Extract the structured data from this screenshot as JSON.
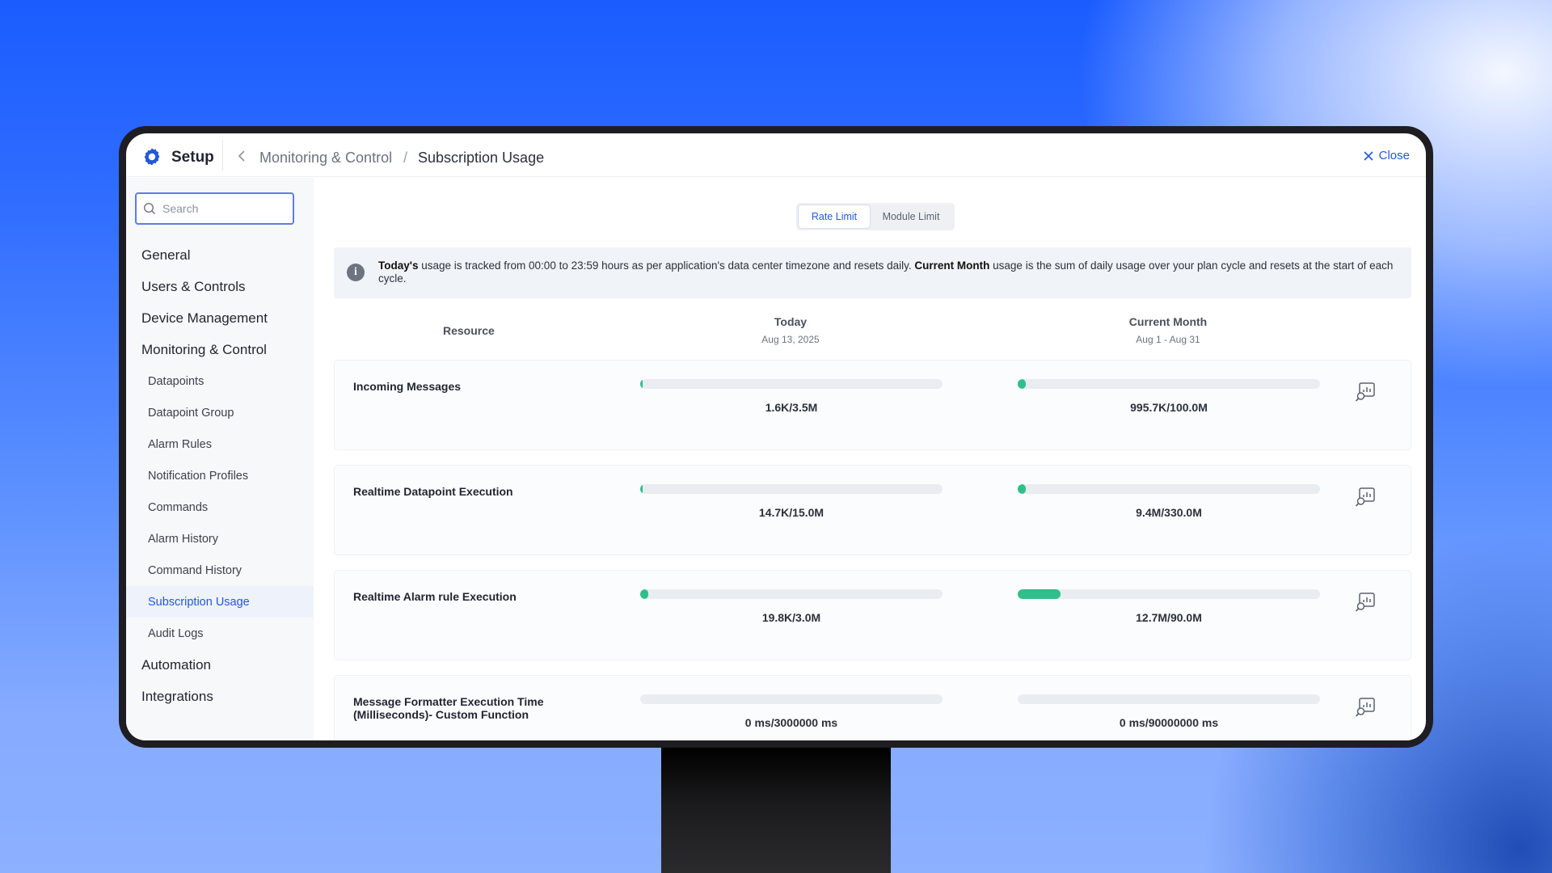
{
  "header": {
    "app_title": "Setup",
    "breadcrumb_parent": "Monitoring & Control",
    "breadcrumb_separator": "/",
    "breadcrumb_current": "Subscription Usage",
    "close_label": "Close"
  },
  "sidebar": {
    "search_placeholder": "Search",
    "items": [
      {
        "label": "General",
        "level": "top"
      },
      {
        "label": "Users & Controls",
        "level": "top"
      },
      {
        "label": "Device Management",
        "level": "top"
      },
      {
        "label": "Monitoring & Control",
        "level": "top"
      },
      {
        "label": "Datapoints",
        "level": "sub"
      },
      {
        "label": "Datapoint Group",
        "level": "sub"
      },
      {
        "label": "Alarm Rules",
        "level": "sub"
      },
      {
        "label": "Notification Profiles",
        "level": "sub"
      },
      {
        "label": "Commands",
        "level": "sub"
      },
      {
        "label": "Alarm History",
        "level": "sub"
      },
      {
        "label": "Command History",
        "level": "sub"
      },
      {
        "label": "Subscription Usage",
        "level": "sub",
        "active": true
      },
      {
        "label": "Audit Logs",
        "level": "sub"
      },
      {
        "label": "Automation",
        "level": "top"
      },
      {
        "label": "Integrations",
        "level": "top"
      }
    ]
  },
  "tabs": {
    "rate_limit": "Rate Limit",
    "module_limit": "Module Limit",
    "selected": "Rate Limit"
  },
  "info": {
    "today_bold": "Today's",
    "text_1": " usage is tracked from 00:00 to 23:59 hours as per application's data center timezone and resets daily. ",
    "month_bold": "Current Month",
    "text_2": " usage is the sum of daily usage over your plan cycle and resets at the start of each cycle."
  },
  "columns": {
    "resource": "Resource",
    "today": "Today",
    "today_date": "Aug 13, 2025",
    "month": "Current Month",
    "month_range": "Aug 1 - Aug 31"
  },
  "rows": [
    {
      "name": "Incoming Messages",
      "today_value": "1.6K/3.5M",
      "today_fraction": 0.0005,
      "month_value": "995.7K/100.0M",
      "month_fraction": 0.01
    },
    {
      "name": "Realtime Datapoint Execution",
      "today_value": "14.7K/15.0M",
      "today_fraction": 0.001,
      "month_value": "9.4M/330.0M",
      "month_fraction": 0.028
    },
    {
      "name": "Realtime Alarm rule Execution",
      "today_value": "19.8K/3.0M",
      "today_fraction": 0.0066,
      "month_value": "12.7M/90.0M",
      "month_fraction": 0.141
    },
    {
      "name": "Message Formatter Execution Time (Milliseconds)- Custom Function",
      "today_value": "0 ms/3000000 ms",
      "today_fraction": 0,
      "month_value": "0 ms/90000000 ms",
      "month_fraction": 0
    }
  ],
  "colors": {
    "accent": "#2458d6",
    "progress": "#2ebf8a",
    "track": "#e9ecf0"
  }
}
